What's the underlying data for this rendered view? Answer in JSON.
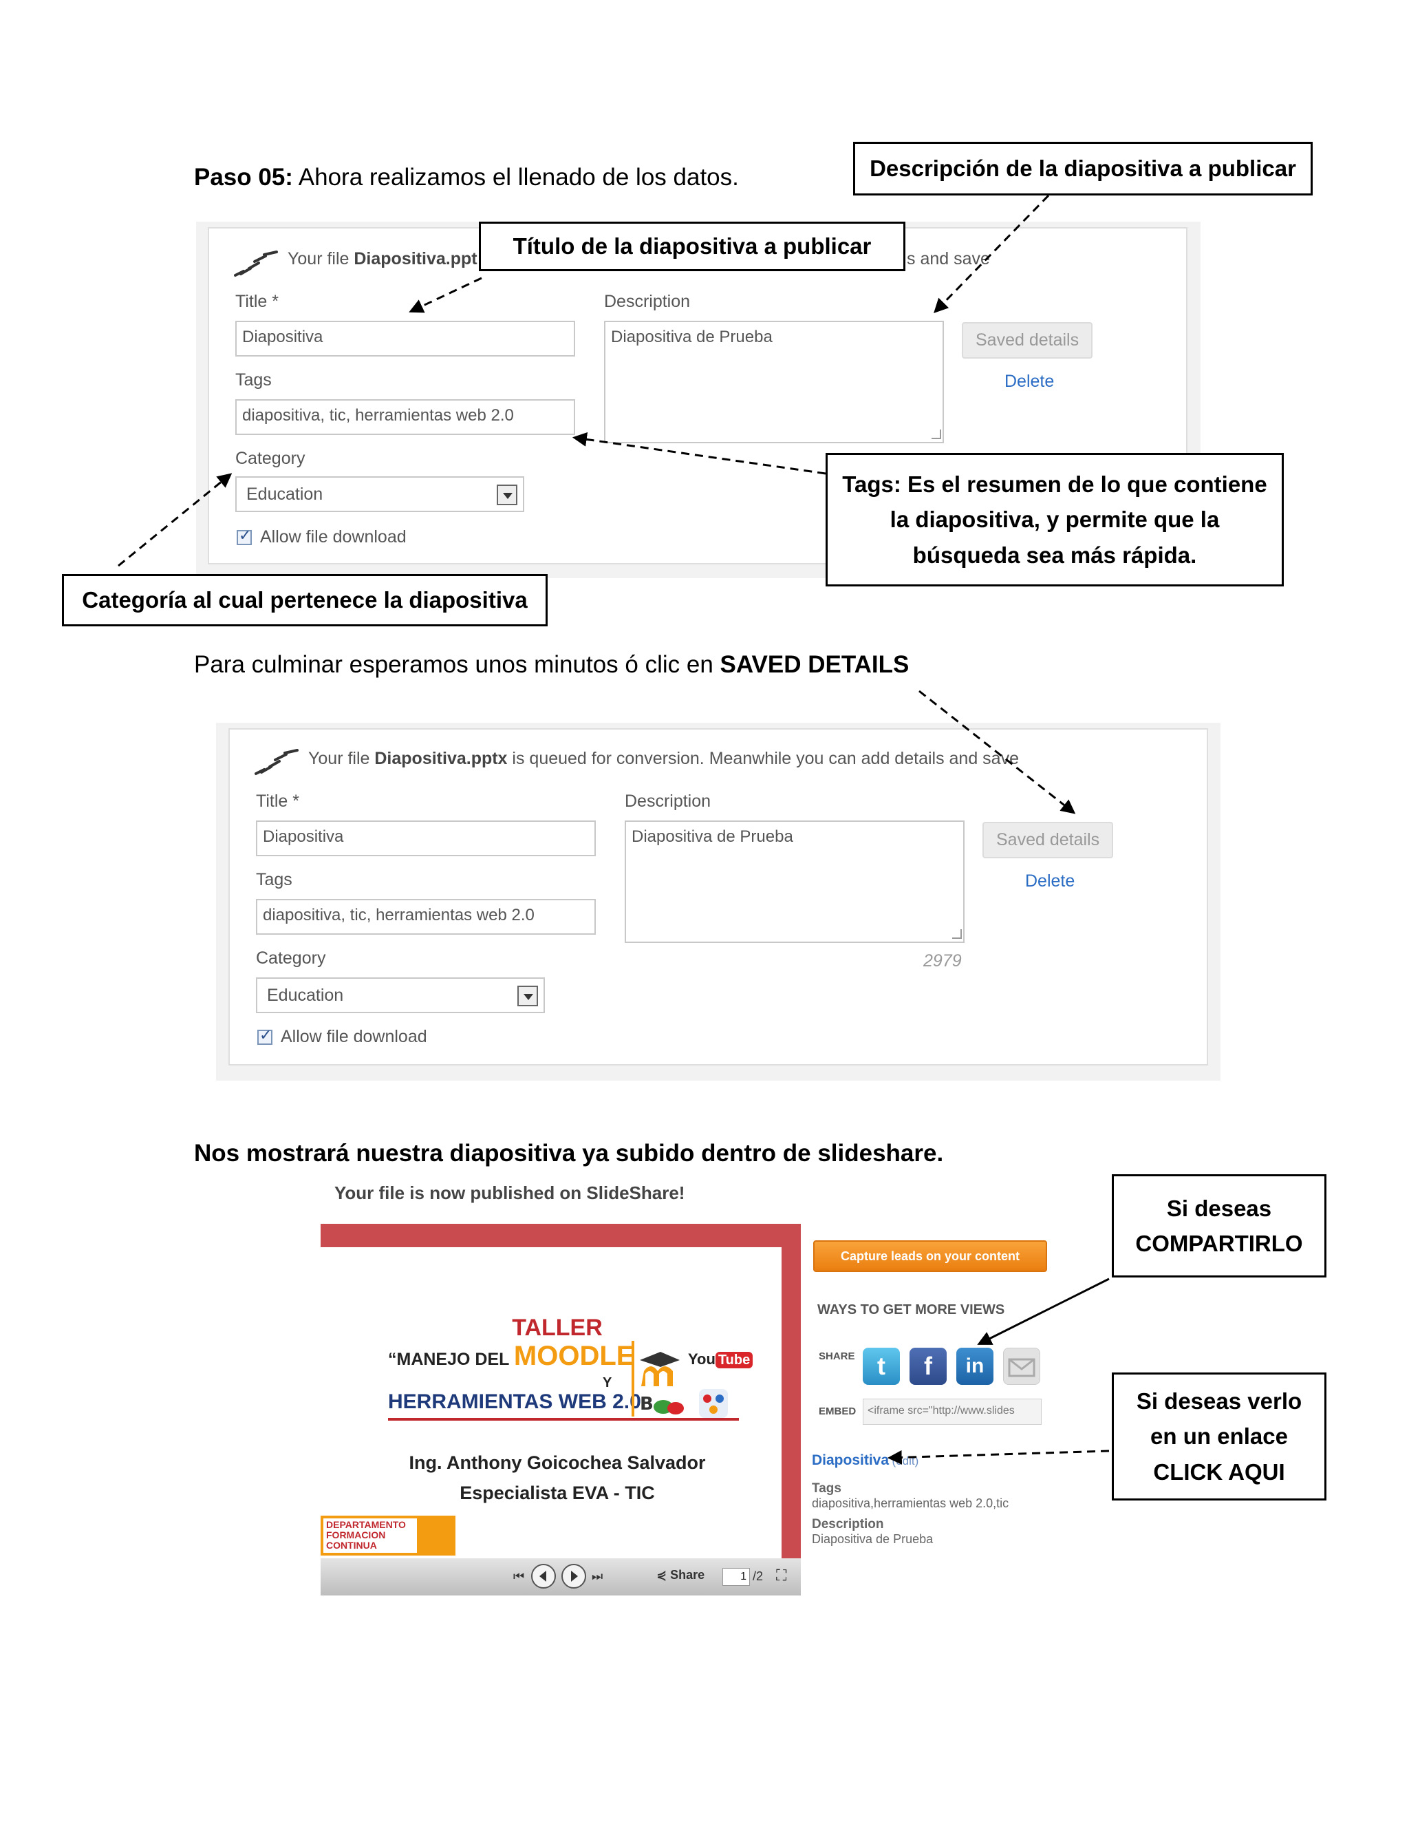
{
  "step": {
    "label": "Paso 05:",
    "text": " Ahora realizamos el llenado de los datos."
  },
  "callouts": {
    "description": "Descripción de la diapositiva a publicar",
    "title": "Título de la diapositiva a publicar",
    "tags_line1": "Tags: Es el resumen de lo que contiene",
    "tags_line2": "la diapositiva, y permite que la",
    "tags_line3": "búsqueda sea más rápida.",
    "category": "Categoría al cual pertenece la diapositiva",
    "share_line1": "Si deseas",
    "share_line2": "COMPARTIRLO",
    "view_line1": "Si deseas verlo",
    "view_line2": "en un enlace",
    "view_line3": "CLICK AQUI"
  },
  "form1": {
    "notice_prefix": "Your file ",
    "notice_file": "Diapositiva.ppt",
    "notice_tail": "s and save",
    "title_label": "Title *",
    "title_value": "Diapositiva",
    "description_label": "Description",
    "description_value": "Diapositiva de Prueba",
    "tags_label": "Tags",
    "tags_value": "diapositiva, tic, herramientas web 2.0",
    "category_label": "Category",
    "category_value": "Education",
    "allow_download": "Allow file download",
    "saved_button": "Saved details",
    "delete_link": "Delete"
  },
  "middle_text": {
    "prefix": "Para culminar esperamos unos minutos ó clic en ",
    "bold": "SAVED DETAILS"
  },
  "form2": {
    "notice_prefix": "Your file ",
    "notice_file": "Diapositiva.pptx",
    "notice_rest": " is queued for conversion. Meanwhile you can add details and save",
    "title_label": "Title *",
    "title_value": "Diapositiva",
    "description_label": "Description",
    "description_value": "Diapositiva de Prueba",
    "char_count": "2979",
    "tags_label": "Tags",
    "tags_value": "diapositiva, tic, herramientas web 2.0",
    "category_label": "Category",
    "category_value": "Education",
    "allow_download": "Allow file download",
    "saved_button": "Saved details",
    "delete_link": "Delete"
  },
  "bottom_heading": "Nos mostrará nuestra diapositiva ya subido dentro de slideshare.",
  "published": {
    "notice": "Your file is now published on SlideShare!",
    "slide": {
      "taller": "TALLER",
      "manejo_del": "“MANEJO DEL ",
      "moodle": "MOODLE",
      "y": "Y",
      "herramientas": "HERRAMIENTAS WEB 2.0",
      "youtube_you": "You",
      "youtube_tube": "Tube",
      "author": "Ing. Anthony Goicochea Salvador",
      "role": "Especialista EVA - TIC",
      "dept_line1": "DEPARTAMENTO",
      "dept_line2": "FORMACION",
      "dept_line3": "CONTINUA"
    },
    "player": {
      "share": "Share",
      "page": "1",
      "total": "/2"
    },
    "capture_button": "Capture leads on your content",
    "ways_title": "WAYS TO GET MORE VIEWS",
    "share_label": "SHARE",
    "embed_label": "EMBED",
    "embed_value": "<iframe src=\"http://www.slides",
    "doc_title": "Diapositiva",
    "edit_link": "(edit)",
    "tags_label": "Tags",
    "tags_value": "diapositiva,herramientas web 2.0,tic",
    "description_label": "Description",
    "description_value": "Diapositiva de Prueba"
  }
}
